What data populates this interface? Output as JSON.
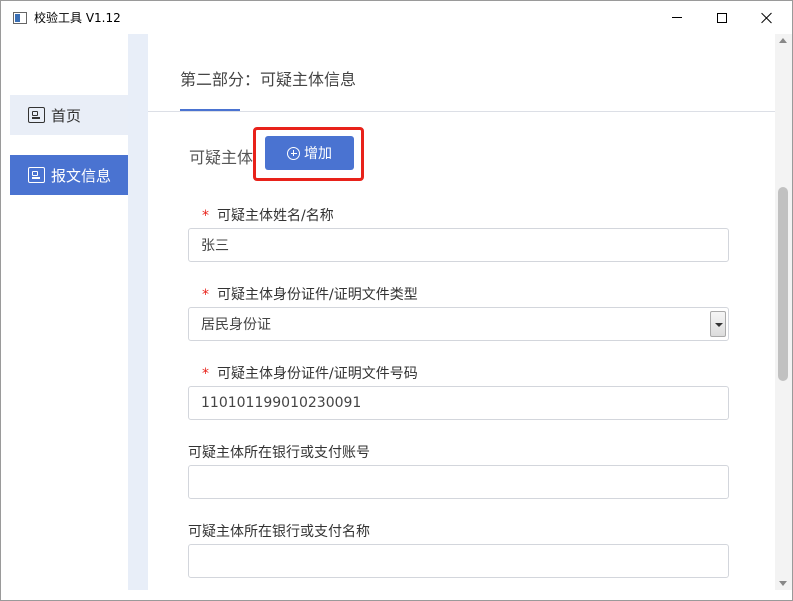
{
  "window": {
    "title": "校验工具 V1.12",
    "icon": "app-window-icon"
  },
  "sidebar": {
    "items": [
      {
        "label": "首页",
        "icon": "card-icon",
        "active": false
      },
      {
        "label": "报文信息",
        "icon": "card-icon",
        "active": true
      }
    ]
  },
  "main": {
    "section_title": "第二部分：可疑主体信息",
    "subject_label": "可疑主体",
    "add_button_label": "增加",
    "fields": [
      {
        "label": "可疑主体姓名/名称",
        "required": true,
        "value": "张三"
      },
      {
        "label": "可疑主体身份证件/证明文件类型",
        "required": true,
        "value": "居民身份证",
        "type": "select"
      },
      {
        "label": "可疑主体身份证件/证明文件号码",
        "required": true,
        "value": "110101199010230091"
      },
      {
        "label": "可疑主体所在银行或支付账号",
        "required": false,
        "value": ""
      },
      {
        "label": "可疑主体所在银行或支付名称",
        "required": false,
        "value": ""
      }
    ],
    "required_mark": "*"
  },
  "colors": {
    "accent": "#4a73d1",
    "highlight": "#e8221a",
    "sidebar_active_bg": "#e9eef7"
  }
}
